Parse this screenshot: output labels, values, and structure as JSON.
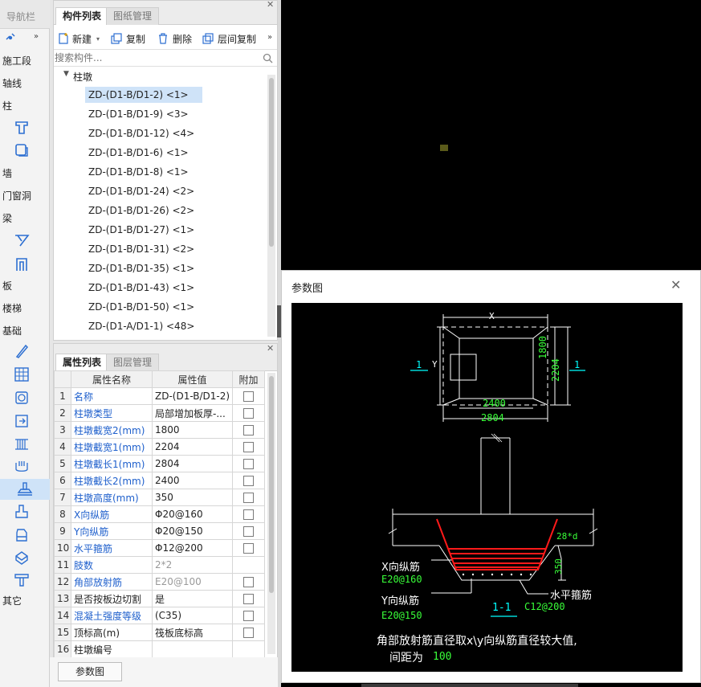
{
  "nav": {
    "title": "导航栏",
    "categories": [
      "施工段",
      "轴线",
      "柱",
      "墙",
      "门窗洞",
      "梁",
      "板",
      "楼梯",
      "基础",
      "其它"
    ]
  },
  "component_panel": {
    "tabs": [
      "构件列表",
      "图纸管理"
    ],
    "toolbar": {
      "new_label": "新建",
      "copy_label": "复制",
      "delete_label": "删除",
      "floor_copy_label": "层间复制"
    },
    "search_placeholder": "搜索构件...",
    "tree_root": "柱墩",
    "items": [
      "ZD-(D1-B/D1-2) <1>",
      "ZD-(D1-B/D1-9) <3>",
      "ZD-(D1-B/D1-12) <4>",
      "ZD-(D1-B/D1-6) <1>",
      "ZD-(D1-B/D1-8) <1>",
      "ZD-(D1-B/D1-24) <2>",
      "ZD-(D1-B/D1-26) <2>",
      "ZD-(D1-B/D1-27) <1>",
      "ZD-(D1-B/D1-31) <2>",
      "ZD-(D1-B/D1-35) <1>",
      "ZD-(D1-B/D1-43) <1>",
      "ZD-(D1-B/D1-50) <1>",
      "ZD-(D1-A/D1-1) <48>"
    ]
  },
  "property_panel": {
    "tabs": [
      "属性列表",
      "图层管理"
    ],
    "headers": {
      "name": "属性名称",
      "value": "属性值",
      "extra": "附加"
    },
    "rows": [
      {
        "no": "1",
        "name": "名称",
        "value": "ZD-(D1-B/D1-2)",
        "blue": true,
        "check": true,
        "grey": false
      },
      {
        "no": "2",
        "name": "柱墩类型",
        "value": "局部增加板厚-...",
        "blue": true,
        "check": true,
        "grey": false
      },
      {
        "no": "3",
        "name": "柱墩截宽2(mm)",
        "value": "1800",
        "blue": true,
        "check": true,
        "grey": false
      },
      {
        "no": "4",
        "name": "柱墩截宽1(mm)",
        "value": "2204",
        "blue": true,
        "check": true,
        "grey": false
      },
      {
        "no": "5",
        "name": "柱墩截长1(mm)",
        "value": "2804",
        "blue": true,
        "check": true,
        "grey": false
      },
      {
        "no": "6",
        "name": "柱墩截长2(mm)",
        "value": "2400",
        "blue": true,
        "check": true,
        "grey": false
      },
      {
        "no": "7",
        "name": "柱墩高度(mm)",
        "value": "350",
        "blue": true,
        "check": true,
        "grey": false
      },
      {
        "no": "8",
        "name": "X向纵筋",
        "value": "Φ20@160",
        "blue": true,
        "check": true,
        "grey": false
      },
      {
        "no": "9",
        "name": "Y向纵筋",
        "value": "Φ20@150",
        "blue": true,
        "check": true,
        "grey": false
      },
      {
        "no": "10",
        "name": "水平箍筋",
        "value": "Φ12@200",
        "blue": true,
        "check": true,
        "grey": false
      },
      {
        "no": "11",
        "name": "肢数",
        "value": "2*2",
        "blue": true,
        "check": false,
        "grey": true
      },
      {
        "no": "12",
        "name": "角部放射筋",
        "value": "E20@100",
        "blue": true,
        "check": true,
        "grey": true
      },
      {
        "no": "13",
        "name": "是否按板边切割",
        "value": "是",
        "blue": false,
        "check": true,
        "grey": false
      },
      {
        "no": "14",
        "name": "混凝土强度等级",
        "value": "(C35)",
        "blue": true,
        "check": true,
        "grey": false
      },
      {
        "no": "15",
        "name": "顶标高(m)",
        "value": "筏板底标高",
        "blue": false,
        "check": true,
        "grey": false
      },
      {
        "no": "16",
        "name": "柱墩编号",
        "value": "",
        "blue": false,
        "check": false,
        "grey": false
      }
    ],
    "param_button": "参数图"
  },
  "dialog": {
    "title": "参数图",
    "drawing": {
      "dim_x": "X",
      "dim_y": "Y",
      "dim_2400": "2400",
      "dim_2804": "2804",
      "dim_1800": "1800",
      "dim_2204": "2204",
      "section_mark": "1",
      "dim_350": "350",
      "dim_28d": "28*d",
      "label_x_rebar": "X向纵筋",
      "val_x_rebar": "E20@160",
      "label_y_rebar": "Y向纵筋",
      "val_y_rebar": "E20@150",
      "label_stirrup": "水平箍筋",
      "val_stirrup": "C12@200",
      "section_title": "1-1",
      "note_line1": "角部放射筋直径取x\\y向纵筋直径较大值,",
      "note_line2_prefix": "间距为",
      "note_line2_value": "100"
    }
  },
  "colors": {
    "cad_white": "#ffffff",
    "cad_green": "#39ff39",
    "cad_cyan": "#00ffff",
    "cad_red": "#ff1a1a",
    "selection": "#cfe3f8",
    "link_blue": "#1e5fcc"
  }
}
